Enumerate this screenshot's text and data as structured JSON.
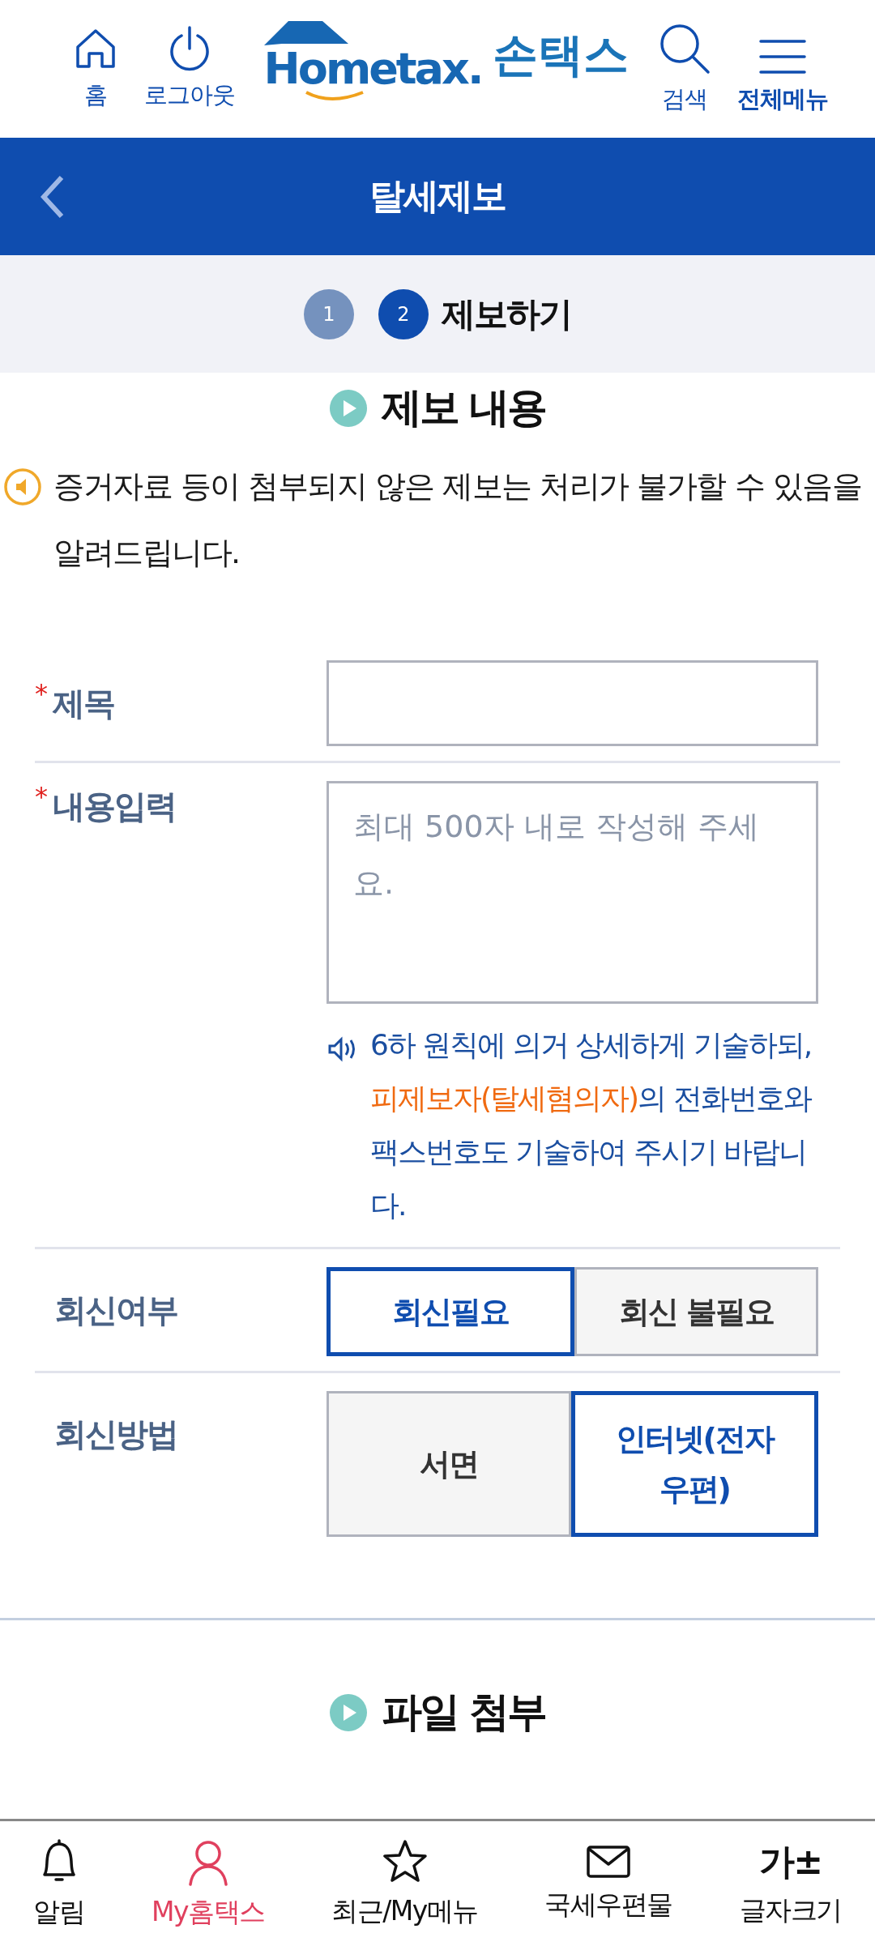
{
  "header": {
    "left_actions": [
      {
        "kind": "home",
        "label": "홈"
      },
      {
        "kind": "power",
        "label": "로그아웃"
      }
    ],
    "logo": {
      "brand": "Hometax.",
      "app": "손택스"
    },
    "right_actions": [
      {
        "kind": "search",
        "label": "검색",
        "bold": false
      },
      {
        "kind": "menu",
        "label": "전체메뉴",
        "bold": true
      }
    ]
  },
  "title_bar": {
    "title": "탈세제보"
  },
  "steps": [
    {
      "number": "1",
      "selected": false
    },
    {
      "number": "2",
      "selected": true,
      "label": "제보하기"
    }
  ],
  "section": {
    "title": "제보 내용"
  },
  "notice": "증거자료 등이 첨부되지 않은 제보는 처리가 불가할 수 있음을 알려드립니다.",
  "form": [
    {
      "kind": "input",
      "label": "제목",
      "required_mark": "*"
    },
    {
      "kind": "textarea",
      "label": "내용입력",
      "required_mark": "*",
      "placeholder": "최대 500자 내로 작성해 주세요.",
      "hint": [
        {
          "text": "6하 원칙에 의거 상세하게 기술하되, ",
          "highlight": false
        },
        {
          "text": "피제보자(탈세혐의자)",
          "highlight": true
        },
        {
          "text": "의 전화번호와 팩스번호도 기술하여 주시기 바랍니다.",
          "highlight": false
        }
      ]
    },
    {
      "kind": "choice",
      "label": "회신여부",
      "options": [
        {
          "label": "회신필요",
          "selected": true
        },
        {
          "label": "회신 불필요",
          "selected": false
        }
      ]
    },
    {
      "kind": "choice",
      "label": "회신방법",
      "options": [
        {
          "label": "서면",
          "selected": false
        },
        {
          "label": "인터넷(전자우편)",
          "selected": true
        }
      ]
    }
  ],
  "attach_section": {
    "title": "파일 첨부"
  },
  "bottom_nav": [
    {
      "kind": "bell",
      "label": "알림",
      "selected": false
    },
    {
      "kind": "person",
      "label": "My홈택스",
      "selected": true
    },
    {
      "kind": "star",
      "label": "최근/My메뉴",
      "selected": false
    },
    {
      "kind": "mail",
      "label": "국세우편물",
      "selected": false
    },
    {
      "kind": "font",
      "glyph": "가±",
      "label": "글자크기",
      "selected": false
    }
  ]
}
